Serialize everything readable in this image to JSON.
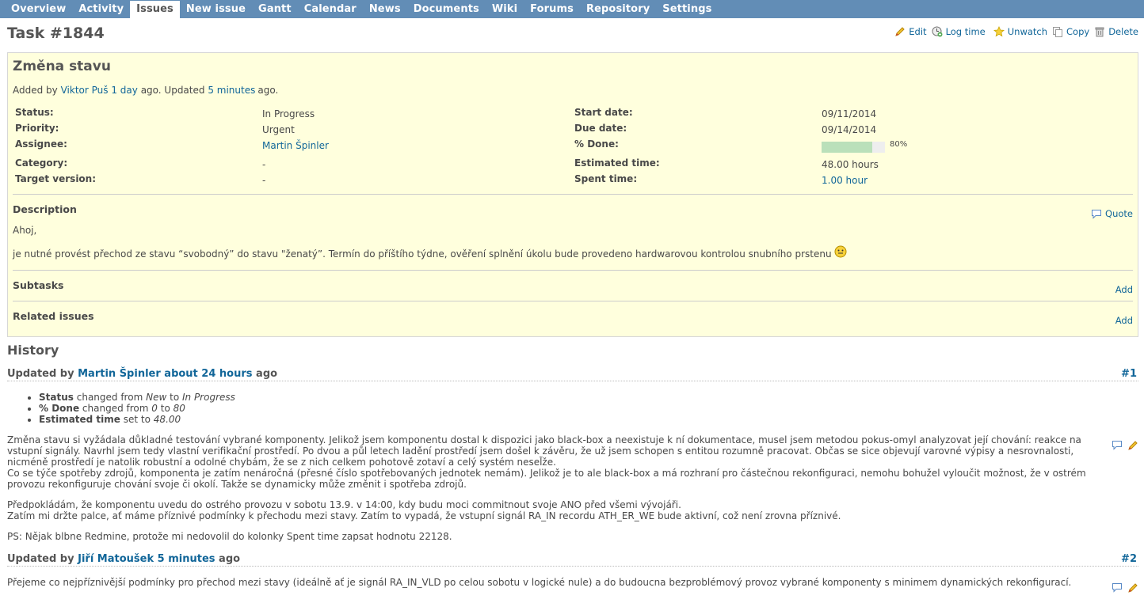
{
  "menu": [
    "Overview",
    "Activity",
    "Issues",
    "New issue",
    "Gantt",
    "Calendar",
    "News",
    "Documents",
    "Wiki",
    "Forums",
    "Repository",
    "Settings"
  ],
  "title": "Task #1844",
  "actions": {
    "edit": "Edit",
    "log_time": "Log time",
    "unwatch": "Unwatch",
    "copy": "Copy",
    "delete": "Delete"
  },
  "issue": {
    "subject": "Změna stavu",
    "added_by_prefix": "Added by",
    "author": "Viktor Puš",
    "added_ago": "1 day",
    "updated_mid": "ago. Updated",
    "updated_ago": "5 minutes",
    "ago": "ago.",
    "status_label": "Status:",
    "status": "In Progress",
    "priority_label": "Priority:",
    "priority": "Urgent",
    "assignee_label": "Assignee:",
    "assignee": "Martin Špinler",
    "category_label": "Category:",
    "category": "-",
    "target_label": "Target version:",
    "target": "-",
    "start_label": "Start date:",
    "start": "09/11/2014",
    "due_label": "Due date:",
    "due": "09/14/2014",
    "done_label": "% Done:",
    "done_pct": "80%",
    "done_fraction": 0.8,
    "est_label": "Estimated time:",
    "est": "48.00 hours",
    "spent_label": "Spent time:",
    "spent": "1.00 hour",
    "description_label": "Description",
    "quote": "Quote",
    "desc_line1": "Ahoj,",
    "desc_line2": "je nutné provést přechod ze stavu “svobodný” do stavu \"ženatý”. Termín do příštího týdne, ověření splnění úkolu bude provedeno hardwarovou kontrolou snubního prstenu",
    "subtasks_label": "Subtasks",
    "related_label": "Related issues",
    "add": "Add"
  },
  "history": {
    "title": "History",
    "updated_by": "Updated by",
    "ago": "ago",
    "j1": {
      "author": "Martin Špinler",
      "time": "about 24 hours",
      "num": "#1",
      "d1_field": "Status",
      "d1_mid1": "changed from",
      "d1_from": "New",
      "d1_mid2": "to",
      "d1_to": "In Progress",
      "d2_field": "% Done",
      "d2_mid1": "changed from",
      "d2_from": "0",
      "d2_mid2": "to",
      "d2_to": "80",
      "d3_field": "Estimated time",
      "d3_mid": "set to",
      "d3_to": "48.00",
      "p1": "Změna stavu si vyžádala důkladné testování vybrané komponenty. Jelikož jsem komponentu dostal k dispozici jako black-box a neexistuje k ní dokumentace, musel jsem metodou pokus-omyl analyzovat její chování: reakce na vstupní signály. Navrhl jsem tedy vlastní verifikační prostředí. Po dvou a půl letech ladění prostředí jsem došel k závěru, že už jsem schopen s entitou rozumně pracovat. Občas se sice objevují varovné výpisy a nesrovnalosti, nicméně prostředí je natolik robustní a odolné chybám, že se z nich celkem pohotově zotaví a celý systém nesel̃že.",
      "p1b": "Co se týče spotřeby zdrojů, komponenta je zatím nenáročná (přesné číslo spotřebovaných jednotek nemám). Jelikož je to ale black-box a má rozhraní pro částečnou rekonfiguraci, nemohu bohužel vyloučit možnost, že v ostrém provozu rekonfiguruje chování svoje či okolí. Takže se dynamicky může změnit i spotřeba zdrojů.",
      "p2": "Předpokládám, že komponentu uvedu do ostrého provozu v sobotu 13.9. v 14:00, kdy budu moci commitnout svoje ANO před všemi vývojáři.",
      "p2b": "Zatím mi držte palce, ať máme příznivé podmínky k přechodu mezi stavy. Zatím to vypadá, že vstupní signál RA_IN recordu ATH_ER_WE bude aktivní, což není zrovna příznivé.",
      "p3": "PS: Nějak blbne Redmine, protože mi nedovolil do kolonky Spent time zapsat hodnotu 22128."
    },
    "j2": {
      "author": "Jiří Matoušek",
      "time": "5 minutes",
      "num": "#2",
      "p1": "Přejeme co nejpříznivější podmínky pro přechod mezi stavy (ideálně ať je signál RA_IN_VLD po celou sobotu v logické nule) a do budoucna bezproblémový provoz vybrané komponenty s minimem dynamických rekonfigurací."
    }
  }
}
